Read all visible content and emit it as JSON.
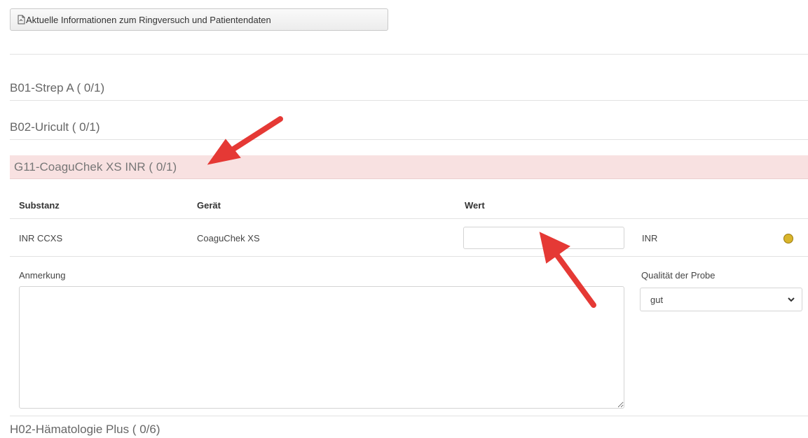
{
  "toolbar": {
    "info_button_label": "Aktuelle Informationen zum Ringversuch und Patientendaten"
  },
  "sections": [
    {
      "title": "B01-Strep A ( 0/1)"
    },
    {
      "title": "B02-Uricult ( 0/1)"
    },
    {
      "title": "G11-CoaguChek XS INR ( 0/1)"
    },
    {
      "title": "H02-Hämatologie Plus ( 0/6)"
    }
  ],
  "table": {
    "headers": {
      "substanz": "Substanz",
      "geraet": "Gerät",
      "wert": "Wert"
    },
    "row": {
      "substanz": "INR CCXS",
      "geraet": "CoaguChek XS",
      "wert": "",
      "unit": "INR"
    }
  },
  "note": {
    "label": "Anmerkung",
    "value": ""
  },
  "quality": {
    "label": "Qualität der Probe",
    "selected": "gut"
  },
  "colors": {
    "active_section_bg": "#f8e1e1",
    "annotation_arrow": "#e53935"
  }
}
